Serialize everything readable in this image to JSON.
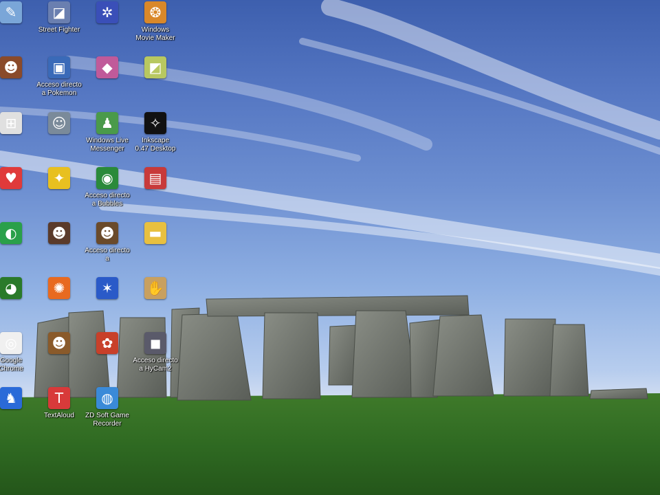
{
  "desktop": {
    "icons": [
      {
        "label": "",
        "icon": "app-icon",
        "color": "#7aa6d8",
        "glyph": "✎"
      },
      {
        "label": "Street Fighter\n",
        "icon": "app-icon",
        "color": "#6a7fb0",
        "glyph": "◪"
      },
      {
        "label": "",
        "icon": "app-icon",
        "color": "#3a4fb8",
        "glyph": "✲"
      },
      {
        "label": "Windows\nMovie Maker",
        "icon": "movie-maker-icon",
        "color": "#d9882a",
        "glyph": "❂"
      },
      {
        "label": "",
        "icon": "app-icon",
        "color": "#8a4a2a",
        "glyph": "☻"
      },
      {
        "label": "Acceso directo\na Pokemon",
        "icon": "app-icon",
        "color": "#3a6ab8",
        "glyph": "▣"
      },
      {
        "label": "",
        "icon": "app-icon",
        "color": "#c05a9a",
        "glyph": "◆"
      },
      {
        "label": "",
        "icon": "app-icon",
        "color": "#b8c860",
        "glyph": "◩"
      },
      {
        "label": "",
        "icon": "windows-logo-icon",
        "color": "#e0e0e0",
        "glyph": "⊞"
      },
      {
        "label": "",
        "icon": "app-icon",
        "color": "#7a8a9a",
        "glyph": "☺"
      },
      {
        "label": "Windows Live\nMessenger",
        "icon": "messenger-icon",
        "color": "#4a9a4a",
        "glyph": "♟"
      },
      {
        "label": "Inkscape\n0.47 Desktop",
        "icon": "inkscape-icon",
        "color": "#111111",
        "glyph": "✧"
      },
      {
        "label": "",
        "icon": "app-icon",
        "color": "#e03a3a",
        "glyph": "♥"
      },
      {
        "label": "",
        "icon": "app-icon",
        "color": "#e8c020",
        "glyph": "✦"
      },
      {
        "label": "Acceso directo\na Bubbles",
        "icon": "app-icon",
        "color": "#2a8a3a",
        "glyph": "◉"
      },
      {
        "label": "",
        "icon": "app-icon",
        "color": "#c83a3a",
        "glyph": "▤"
      },
      {
        "label": "",
        "icon": "app-icon",
        "color": "#2aa04a",
        "glyph": "◐"
      },
      {
        "label": "",
        "icon": "app-icon",
        "color": "#5a3a2a",
        "glyph": "☻"
      },
      {
        "label": "Acceso directo\na",
        "icon": "app-icon",
        "color": "#6a4a2a",
        "glyph": "☻"
      },
      {
        "label": "",
        "icon": "folder-icon",
        "color": "#e8c040",
        "glyph": "▬"
      },
      {
        "label": "",
        "icon": "app-icon",
        "color": "#2a7a2a",
        "glyph": "◕"
      },
      {
        "label": "",
        "icon": "app-icon",
        "color": "#e86a20",
        "glyph": "✺"
      },
      {
        "label": "",
        "icon": "app-icon",
        "color": "#2a5ac8",
        "glyph": "✶"
      },
      {
        "label": "",
        "icon": "app-icon",
        "color": "#c8a060",
        "glyph": "✋"
      },
      {
        "label": "Google\nChrome",
        "icon": "chrome-icon",
        "color": "#f0f0f0",
        "glyph": "◎"
      },
      {
        "label": "",
        "icon": "app-icon",
        "color": "#8a5a2a",
        "glyph": "☻"
      },
      {
        "label": "",
        "icon": "app-icon",
        "color": "#c8402a",
        "glyph": "✿"
      },
      {
        "label": "Acceso directo\na HyCam2",
        "icon": "camera-icon",
        "color": "#5a5a6a",
        "glyph": "◼"
      },
      {
        "label": "",
        "icon": "app-icon",
        "color": "#2a6ad8",
        "glyph": "♞"
      },
      {
        "label": "TextAloud",
        "icon": "textaloud-icon",
        "color": "#d83a3a",
        "glyph": "T"
      },
      {
        "label": "ZD Soft Game\nRecorder",
        "icon": "game-recorder-icon",
        "color": "#3a8ad8",
        "glyph": "◍"
      }
    ]
  }
}
